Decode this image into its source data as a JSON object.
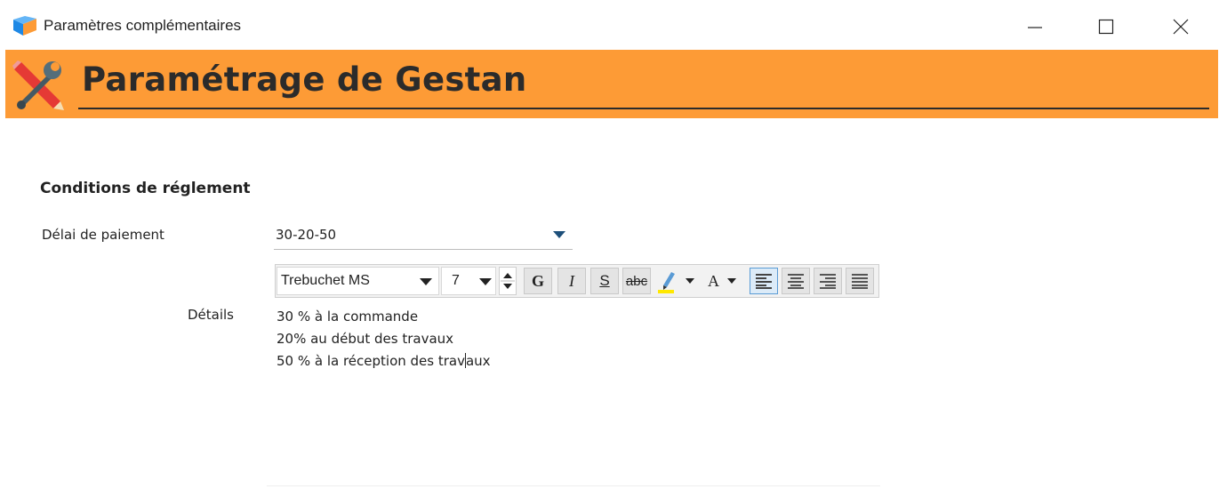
{
  "window": {
    "title": "Paramètres complémentaires",
    "controls": {
      "minimize_icon": "minimize-icon",
      "maximize_icon": "maximize-icon",
      "close_icon": "close-icon"
    }
  },
  "banner": {
    "title": "Paramétrage de Gestan",
    "icon": "tools-icon",
    "background": "#fd9b36"
  },
  "form": {
    "section_title": "Conditions de réglement",
    "payment_delay": {
      "label": "Délai de paiement",
      "value": "30-20-50"
    },
    "details": {
      "label": "Détails",
      "lines": [
        "30 % à la commande",
        "20% au début des travaux",
        "50 % à la réception des travaux"
      ],
      "caret_split": [
        "50 % à la réception des trav",
        "aux"
      ]
    }
  },
  "toolbar": {
    "font_family": "Trebuchet MS",
    "font_size": "7",
    "bold_label": "G",
    "italic_label": "I",
    "underline_label": "S",
    "strikethrough_label": "abc",
    "font_color_label": "A",
    "alignment_selected": "left",
    "colors": {
      "accent": "#5a9bd5",
      "highlight": "#ffe800"
    }
  }
}
